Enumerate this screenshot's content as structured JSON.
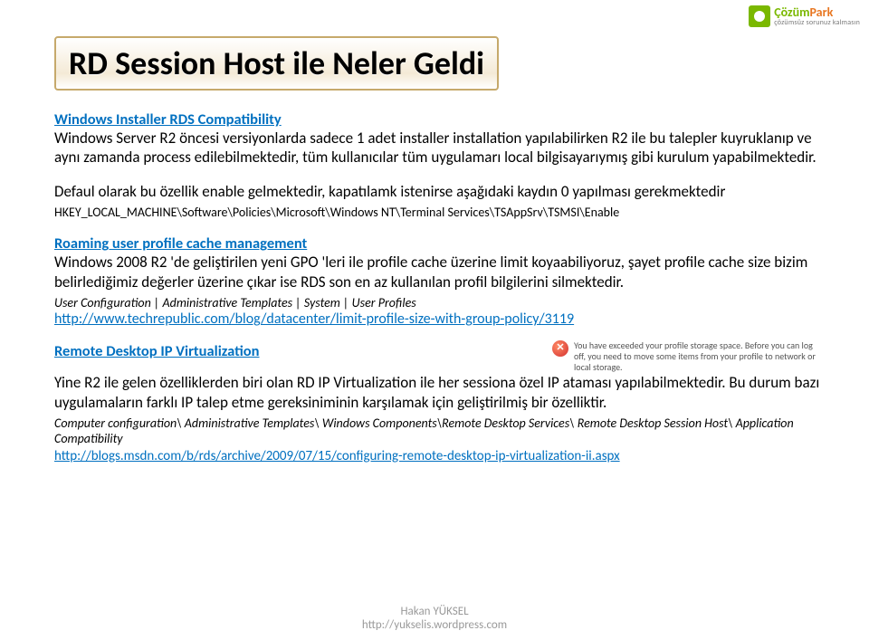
{
  "logo": {
    "brand1": "Çözüm",
    "brand2": "Park",
    "tagline": "çözümsüz sorunuz kalmasın"
  },
  "title": "RD Session Host ile Neler Geldi",
  "sections": {
    "s1": {
      "heading": "Windows Installer RDS Compatibility",
      "p1": "Windows Server R2 öncesi versiyonlarda sadece 1 adet installer installation yapılabilirken R2 ile bu talepler kuyruklanıp ve aynı zamanda process edilebilmektedir, tüm kullanıcılar tüm uygulamarı local bilgisayarıymış gibi kurulum yapabilmektedir.",
      "p2": "Defaul olarak bu özellik enable gelmektedir, kapatılamk istenirse aşağıdaki kaydın 0 yapılması gerekmektedir",
      "reg": "HKEY_LOCAL_MACHINE\\Software\\Policies\\Microsoft\\Windows NT\\Terminal Services\\TSAppSrv\\TSMSI\\Enable"
    },
    "s2": {
      "heading": "Roaming user profile cache management",
      "p1": "Windows 2008 R2 'de geliştirilen yeni GPO 'leri ile profile cache üzerine limit koyaabiliyoruz, şayet profile cache size bizim belirlediğimiz değerler üzerine çıkar ise RDS son en az kullanılan profil bilgilerini silmektedir.",
      "path": "User Configuration | Administrative Templates | System | User Profiles",
      "link": "http://www.techrepublic.com/blog/datacenter/limit-profile-size-with-group-policy/3119"
    },
    "s3": {
      "heading": "Remote Desktop IP Virtualization",
      "warning": "You have exceeded your profile storage space. Before you can log off, you need to move some items from your profile to network or local storage.",
      "p1": "Yine R2 ile gelen özelliklerden biri olan RD IP Virtualization ile her sessiona özel IP ataması yapılabilmektedir. Bu durum bazı uygulamaların farklı IP talep etme gereksiniminin karşılamak için geliştirilmiş bir özelliktir.",
      "path": "Computer configuration\\ Administrative Templates\\ Windows Components\\Remote Desktop Services\\ Remote Desktop Session Host\\ Application Compatibility",
      "link": "http://blogs.msdn.com/b/rds/archive/2009/07/15/configuring-remote-desktop-ip-virtualization-ii.aspx"
    }
  },
  "footer": {
    "line1": "Hakan YÜKSEL",
    "line2": "http://yukselis.wordpress.com"
  }
}
